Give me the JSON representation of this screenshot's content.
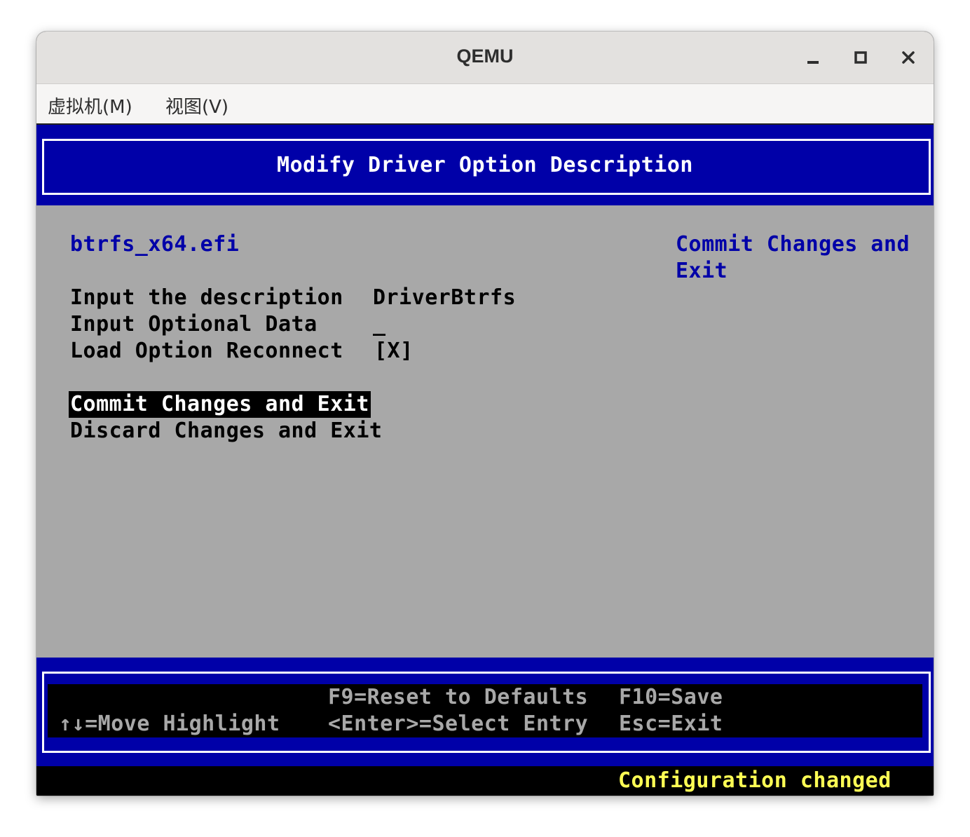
{
  "window": {
    "title": "QEMU",
    "controls": {
      "minimize_icon": "minimize-icon",
      "maximize_icon": "maximize-icon",
      "close_icon": "close-icon"
    }
  },
  "menubar": {
    "items": [
      {
        "label": "虚拟机(M)"
      },
      {
        "label": "视图(V)"
      }
    ]
  },
  "bios": {
    "header_title": "Modify Driver Option Description",
    "driver_file": "btrfs_x64.efi",
    "fields": [
      {
        "label": "Input the description",
        "value": "DriverBtrfs"
      },
      {
        "label": "Input Optional Data",
        "value": "_"
      },
      {
        "label": "Load Option Reconnect",
        "value": "[X]"
      }
    ],
    "actions": [
      {
        "label": "Commit Changes and Exit",
        "selected": true
      },
      {
        "label": "Discard Changes and Exit",
        "selected": false
      }
    ],
    "help_text": [
      "Commit Changes and",
      "Exit"
    ],
    "footer": {
      "move": "↑↓=Move Highlight",
      "reset": "F9=Reset to Defaults",
      "select": "<Enter>=Select Entry",
      "save": "F10=Save",
      "exit": "Esc=Exit"
    },
    "status": "Configuration changed",
    "colors": {
      "blue": "#0000a8",
      "gray": "#a8a8a8",
      "yellow": "#ffff54",
      "black": "#000000",
      "white": "#ffffff"
    }
  }
}
